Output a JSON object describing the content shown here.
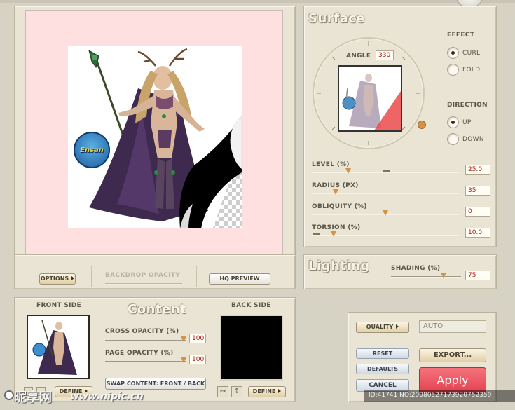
{
  "preview": {
    "options_label": "OPTIONS",
    "backdrop_opacity_label": "BACKDROP OPACITY",
    "hq_preview_label": "HQ PREVIEW",
    "badge_text": "Ensan"
  },
  "surface": {
    "title": "Surface",
    "angle_label": "ANGLE",
    "angle_value": "330",
    "effect_label": "EFFECT",
    "effect_options": [
      "CURL",
      "FOLD"
    ],
    "effect_selected": "CURL",
    "direction_label": "DIRECTION",
    "direction_options": [
      "UP",
      "DOWN"
    ],
    "direction_selected": "UP",
    "sliders": [
      {
        "label": "LEVEL (%)",
        "value": "25.0",
        "level": 0.25
      },
      {
        "label": "RADIUS (PX)",
        "value": "35",
        "level": 0.16
      },
      {
        "label": "OBLIQUITY (%)",
        "value": "0",
        "level": 0.5
      },
      {
        "label": "TORSION (%)",
        "value": "10.0",
        "level": 0.15
      }
    ]
  },
  "lighting": {
    "title": "Lighting",
    "shading_label": "SHADING (%)",
    "shading_value": "75",
    "shading_level": 0.75
  },
  "content": {
    "title": "Content",
    "front_side_label": "FRONT SIDE",
    "back_side_label": "BACK SIDE",
    "cross_opacity_label": "CROSS OPACITY (%)",
    "cross_opacity_value": "100",
    "page_opacity_label": "PAGE OPACITY (%)",
    "page_opacity_value": "100",
    "swap_label": "SWAP CONTENT: FRONT / BACK",
    "define_label": "DEFINE",
    "back_define_label": "DEFINE",
    "flip_h_glyph": "↔",
    "flip_v_glyph": "↕"
  },
  "output": {
    "quality_label": "QUALITY",
    "quality_value": "AUTO",
    "reset_label": "RESET",
    "defaults_label": "DEFAULTS",
    "cancel_label": "CANCEL",
    "export_label": "EXPORT...",
    "apply_label": "Apply"
  },
  "watermark": {
    "logo_text": "昵享网",
    "url_text": "www.nipic.cn",
    "id_text": "ID:41741 NO:20080527173920752359"
  },
  "colors": {
    "canvas_bg": "#fde0df",
    "accent_orange": "#d49247",
    "value_red": "#a3201a",
    "apply_red": "#ee4a57"
  }
}
